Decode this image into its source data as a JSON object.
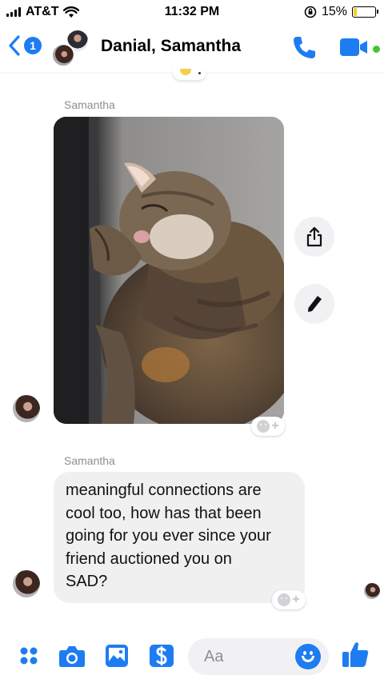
{
  "status_bar": {
    "carrier": "AT&T",
    "time": "11:32 PM",
    "battery_percent": "15%",
    "battery_level": 0.15,
    "signal_bars": 4,
    "icons": [
      "signal-icon",
      "wifi-icon",
      "orientation-lock-icon",
      "battery-icon"
    ]
  },
  "header": {
    "back_badge": "1",
    "title": "Danial, Samantha",
    "online_status_color": "#42c62f"
  },
  "messages": [
    {
      "sender": "Samantha",
      "type": "photo",
      "photo_subject": "sleeping tabby cat"
    },
    {
      "sender": "Samantha",
      "type": "text",
      "text": "meaningful connections are\ncool too, how has that been\ngoing for you ever since your\nfriend auctioned you on\nSAD?"
    }
  ],
  "photo_actions": [
    "share-icon",
    "edit-pencil-icon"
  ],
  "reaction_add_label": "+",
  "composer": {
    "placeholder": "Aa",
    "buttons": [
      "more-dots-icon",
      "camera-icon",
      "gallery-icon",
      "payment-icon",
      "emoji-icon",
      "thumbs-up-icon"
    ]
  },
  "colors": {
    "accent": "#1e7cf2",
    "bubble_gray": "#f1f0f0",
    "sender_gray": "#8e8e93",
    "battery_yellow": "#f4cf28"
  }
}
